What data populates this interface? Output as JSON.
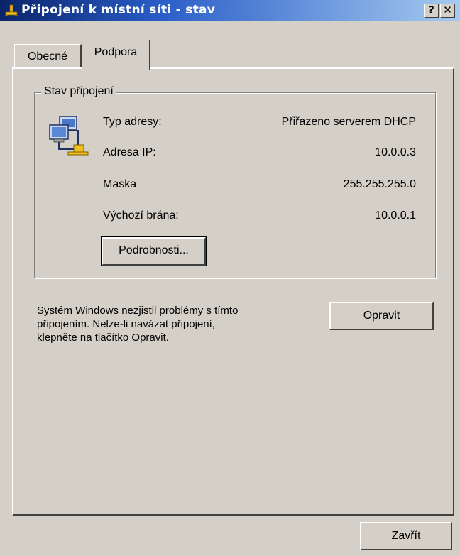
{
  "window": {
    "title": "Připojení k místní síti - stav",
    "help_label": "?",
    "close_label": "✕"
  },
  "tabs": [
    {
      "label": "Obecné",
      "selected": false
    },
    {
      "label": "Podpora",
      "selected": true
    }
  ],
  "connection_status": {
    "group_title": "Stav připojení",
    "icon": "network-connection-icon",
    "rows": [
      {
        "label": "Typ adresy:",
        "value": "Přiřazeno serverem DHCP"
      },
      {
        "label": "Adresa IP:",
        "value": "10.0.0.3"
      },
      {
        "label": "Maska",
        "value": "255.255.255.0"
      },
      {
        "label": "Výchozí brána:",
        "value": "10.0.0.1"
      }
    ],
    "details_button": "Podrobnosti..."
  },
  "repair": {
    "message_lines": [
      "Systém Windows nezjistil problémy s tímto",
      "připojením. Nelze-li navázat připojení,",
      "klepněte na tlačítko Opravit."
    ],
    "repair_button": "Opravit"
  },
  "footer": {
    "close_button": "Zavřít"
  },
  "colors": {
    "face": "#d4d0c8",
    "title_start": "#0a246a",
    "title_end": "#a6caf0"
  }
}
